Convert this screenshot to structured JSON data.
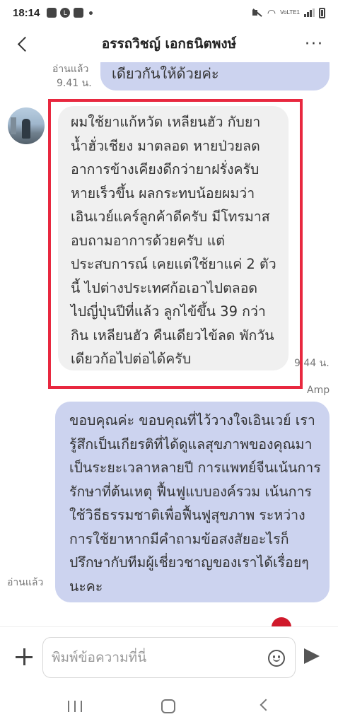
{
  "status_bar": {
    "time": "18:14",
    "line_badge": "L",
    "lte_label": "VoLTE1",
    "icons": [
      "image-icon",
      "line-app-icon",
      "line-chat-icon",
      "mute-icon",
      "wifi-icon",
      "signal-icon",
      "battery-icon"
    ]
  },
  "header": {
    "title": "อรรถวิชญ์ เอกธนิตพงษ์",
    "more": "···"
  },
  "messages": {
    "top": {
      "read_label": "อ่านแล้ว",
      "time": "9.41 น.",
      "text": "เดียวกันให้ด้วยค่ะ"
    },
    "incoming": {
      "text": "ผมใช้ยาแก้หวัด เหลียนฮัว กับยาน้ำฮั่วเชียง มาตลอด หายป่วยลดอาการข้างเคียงดีกว่ายาฝรั่งครับ หายเร็วขึ้น ผลกระทบน้อยผมว่าเอินเวย์แคร์ลูกค้าดีครับ มีโทรมาสอบถามอาการด้วยครับ แต่ประสบการณ์ เคยแต่ใช้ยาแค่ 2 ตัวนี้ ไปต่างประเทศก้อเอาไปตลอด ไปญี่ปุ่นปีที่แล้ว ลูกไข้ขึ้น 39 กว่า กิน เหลียนฮัว คืนเดียวไข้ลด พักวันเดียวก้อไปต่อได้ครับ",
      "time": "9.44 น."
    },
    "reply": {
      "sender": "Amp",
      "text": "ขอบคุณค่ะ ขอบคุณที่ไว้วางใจเอินเวย์ เรารู้สึกเป็นเกียรติที่ได้ดูแลสุขภาพของคุณมาเป็นระยะเวลาหลายปี การแพทย์จีนเน้นการรักษาที่ต้นเหตุ ฟื้นฟูแบบองค์รวม เน้นการใช้วิธีธรรมชาติเพื่อฟื้นฟูสุขภาพ ระหว่างการใช้ยาหากมีคำถามข้อสงสัยอะไรก็ปรึกษากับทีมผู้เชี่ยวชาญของเราได้เรื่อยๆนะคะ",
      "read_label": "อ่านแล้ว"
    }
  },
  "input": {
    "placeholder": "พิมพ์ข้อความที่นี่"
  },
  "colors": {
    "outgoing_bubble": "#ccd3ef",
    "incoming_bubble": "#f0f0f0",
    "highlight": "#e8283f"
  }
}
